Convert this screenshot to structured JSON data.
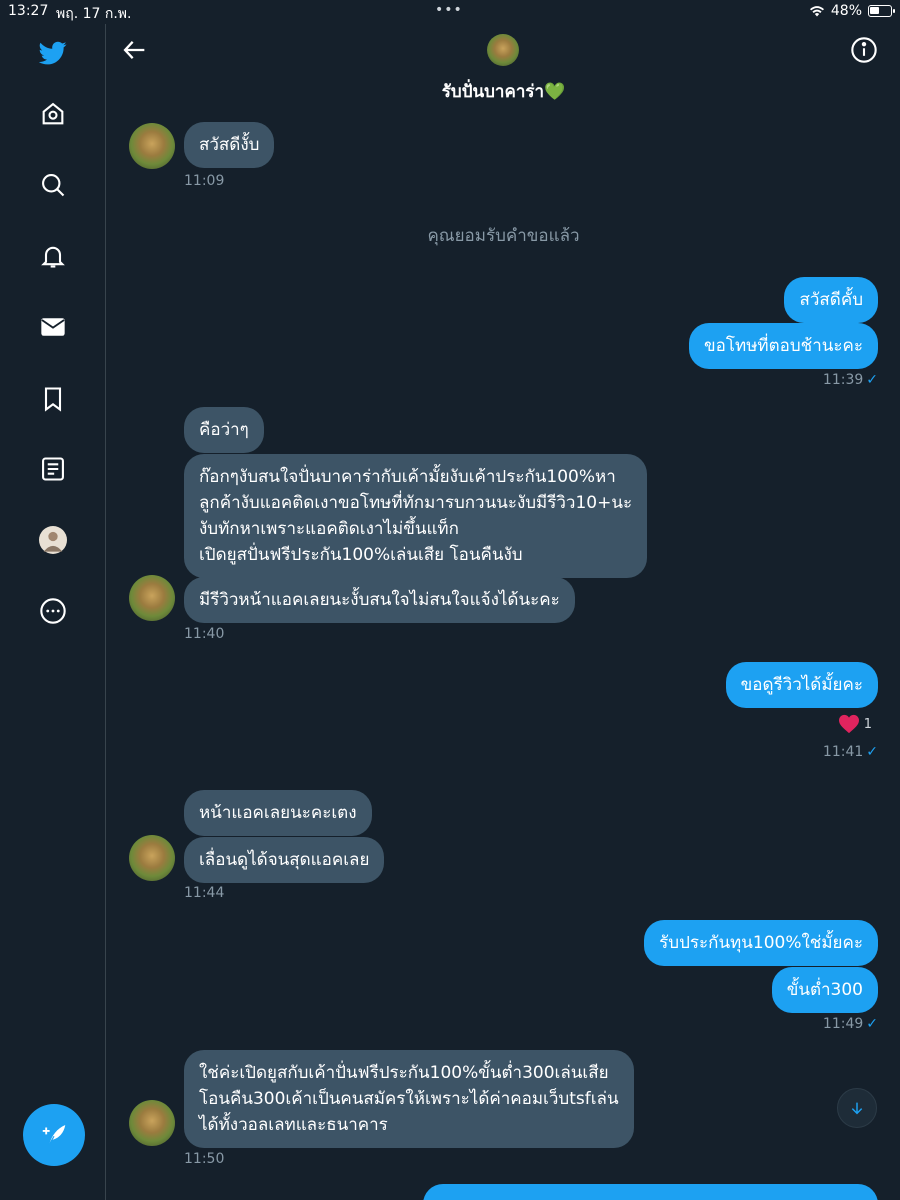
{
  "status_bar": {
    "time": "13:27",
    "date": "พฤ. 17 ก.พ.",
    "dots": "•••",
    "battery": "48%"
  },
  "header": {
    "title": "รับปั่นบาคาร่า",
    "title_emoji": "💚"
  },
  "chat": {
    "messages": [
      {
        "side": "in",
        "text": "สวัสดีงั้บ"
      },
      {
        "side": "in_time",
        "text": "11:09"
      },
      {
        "side": "system",
        "text": "คุณยอมรับคำขอแล้ว"
      },
      {
        "side": "out",
        "text": "สวัสดีคั้บ"
      },
      {
        "side": "out",
        "text": "ขอโทษที่ตอบช้านะคะ"
      },
      {
        "side": "out_time",
        "text": "11:39"
      },
      {
        "side": "in",
        "text": "คือว่าๆ"
      },
      {
        "side": "in",
        "lines": [
          "ก๊อกๆงับสนใจปั่นบาคาร่ากับเค้ามั้ยงับเค้าประกัน100%หา",
          "ลูกค้างับแอคติดเงาขอโทษที่ทักมารบกวนนะงับมีรีวิว10+นะ",
          "งับทักหาเพราะแอคติดเงาไม่ขึ้นแท็ก",
          "เปิดยูสปั่นฟรีประกัน100%เล่นเสีย โอนคืนงับ"
        ]
      },
      {
        "side": "in",
        "text": "มีรีวิวหน้าแอคเลยนะงั้บสนใจไม่สนใจแจ้งได้นะคะ"
      },
      {
        "side": "in_time",
        "text": "11:40"
      },
      {
        "side": "out",
        "text": "ขอดูรีวิวได้มั้ยคะ"
      },
      {
        "side": "reaction",
        "text": "1"
      },
      {
        "side": "out_time",
        "text": "11:41"
      },
      {
        "side": "in",
        "text": "หน้าแอคเลยนะคะเตง"
      },
      {
        "side": "in",
        "text": "เลื่อนดูได้จนสุดแอคเลย"
      },
      {
        "side": "in_time",
        "text": "11:44"
      },
      {
        "side": "out",
        "text": "รับประกันทุน100%ใช่มั้ยคะ"
      },
      {
        "side": "out",
        "text": "ขั้นต่ำ300"
      },
      {
        "side": "out_time",
        "text": "11:49"
      },
      {
        "side": "in",
        "lines": [
          "ใช่ค่ะเปิดยูสกับเค้าปั่นฟรีประกัน100%ขั้นต่ำ300เล่นเสีย",
          "โอนคืน300เค้าเป็นคนสมัครให้เพราะได้ค่าคอมเว็บtsfเล่น",
          "ได้ทั้งวอลเลทและธนาคาร"
        ]
      },
      {
        "side": "in_time",
        "text": "11:50"
      }
    ]
  },
  "colors": {
    "background": "#15202b",
    "incoming_bubble": "#3d5466",
    "outgoing_bubble": "#1da1f2",
    "meta_text": "#8899a6"
  },
  "icons": {
    "sidebar": [
      "twitter-logo-icon",
      "home-icon",
      "search-icon",
      "bell-icon",
      "mail-icon",
      "bookmark-icon",
      "list-icon",
      "profile-avatar",
      "more-icon"
    ],
    "header": [
      "back-arrow-icon",
      "info-icon"
    ],
    "other": [
      "compose-icon",
      "scroll-down-icon",
      "heart-icon",
      "check-icon"
    ]
  }
}
